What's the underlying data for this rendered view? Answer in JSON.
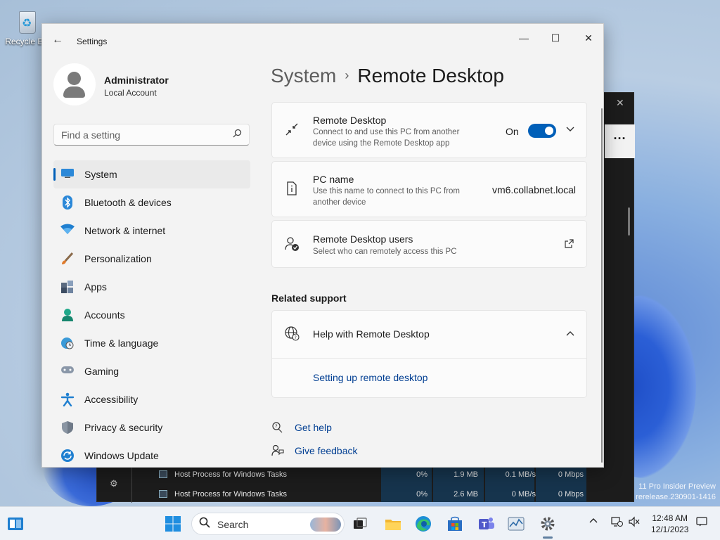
{
  "desktop": {
    "recycle_bin_label": "Recycle Bin",
    "watermark_line1": "11 Pro Insider Preview",
    "watermark_line2": "rerelease.230901-1416"
  },
  "task_manager": {
    "rows": [
      {
        "name": "Host Process for Windows Tasks",
        "cpu": "0%",
        "memory": "1.9 MB",
        "disk": "0.1 MB/s",
        "network": "0 Mbps"
      },
      {
        "name": "Host Process for Windows Tasks",
        "cpu": "0%",
        "memory": "2.6 MB",
        "disk": "0 MB/s",
        "network": "0 Mbps"
      }
    ]
  },
  "window": {
    "title": "Settings",
    "minimize": "—",
    "maximize": "☐",
    "close": "✕"
  },
  "profile": {
    "name": "Administrator",
    "account_type": "Local Account"
  },
  "search": {
    "placeholder": "Find a setting"
  },
  "nav": {
    "items": [
      {
        "label": "System",
        "icon": "system-icon",
        "active": true
      },
      {
        "label": "Bluetooth & devices",
        "icon": "bluetooth-icon"
      },
      {
        "label": "Network & internet",
        "icon": "network-icon"
      },
      {
        "label": "Personalization",
        "icon": "brush-icon"
      },
      {
        "label": "Apps",
        "icon": "apps-icon"
      },
      {
        "label": "Accounts",
        "icon": "accounts-icon"
      },
      {
        "label": "Time & language",
        "icon": "globe-clock-icon"
      },
      {
        "label": "Gaming",
        "icon": "gamepad-icon"
      },
      {
        "label": "Accessibility",
        "icon": "accessibility-icon"
      },
      {
        "label": "Privacy & security",
        "icon": "shield-icon"
      },
      {
        "label": "Windows Update",
        "icon": "update-icon"
      }
    ]
  },
  "page": {
    "breadcrumb_parent": "System",
    "breadcrumb_separator": "›",
    "title": "Remote Desktop"
  },
  "cards": {
    "remote_desktop": {
      "title": "Remote Desktop",
      "description": "Connect to and use this PC from another device using the Remote Desktop app",
      "toggle_state": "On",
      "toggle_on": true
    },
    "pc_name": {
      "title": "PC name",
      "description": "Use this name to connect to this PC from another device",
      "value": "vm6.collabnet.local"
    },
    "users": {
      "title": "Remote Desktop users",
      "description": "Select who can remotely access this PC"
    }
  },
  "related_support": {
    "heading": "Related support",
    "help_title": "Help with Remote Desktop",
    "help_link": "Setting up remote desktop"
  },
  "footer": {
    "get_help": "Get help",
    "give_feedback": "Give feedback"
  },
  "taskbar": {
    "search_label": "Search",
    "time": "12:48 AM",
    "date": "12/1/2023"
  },
  "colors": {
    "accent": "#005fb8",
    "link": "#003e92",
    "window_bg": "#f3f3f3",
    "card_bg": "#fbfbfb"
  }
}
